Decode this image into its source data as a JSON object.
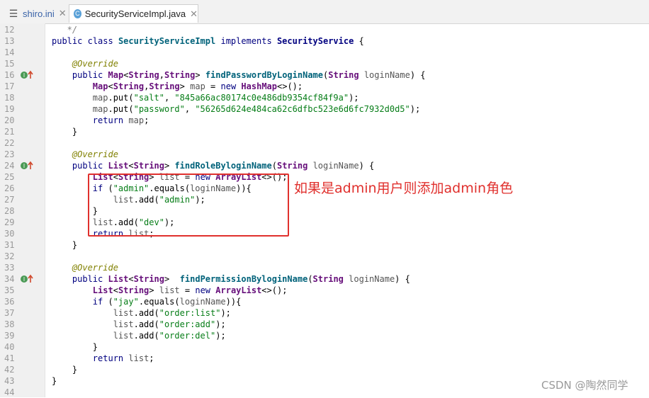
{
  "tabs": [
    {
      "label": "shiro.ini",
      "icon": "ini-file-icon"
    },
    {
      "label": "SecurityServiceImpl.java",
      "icon": "java-class-icon"
    }
  ],
  "gutter": {
    "line_numbers": [
      "12",
      "13",
      "14",
      "15",
      "16",
      "17",
      "18",
      "19",
      "20",
      "21",
      "22",
      "23",
      "24",
      "25",
      "26",
      "27",
      "28",
      "29",
      "30",
      "31",
      "32",
      "33",
      "34",
      "35",
      "36",
      "37",
      "38",
      "39",
      "40",
      "41",
      "42",
      "43",
      "44"
    ],
    "override_markers": [
      "16",
      "24",
      "34"
    ]
  },
  "code": [
    "   */",
    "public class SecurityServiceImpl implements SecurityService {",
    "",
    "    @Override",
    "    public Map<String,String> findPasswordByLoginName(String loginName) {",
    "        Map<String,String> map = new HashMap<>();",
    "        map.put(\"salt\", \"845a66ac80174c0e486db9354cf84f9a\");",
    "        map.put(\"password\", \"56265d624e484ca62c6dfbc523e6d6fc7932d0d5\");",
    "        return map;",
    "    }",
    "",
    "    @Override",
    "    public List<String> findRoleByloginName(String loginName) {",
    "        List<String> list = new ArrayList<>();",
    "        if (\"admin\".equals(loginName)){",
    "            list.add(\"admin\");",
    "        }",
    "        list.add(\"dev\");",
    "        return list;",
    "    }",
    "",
    "    @Override",
    "    public List<String>  findPermissionByloginName(String loginName) {",
    "        List<String> list = new ArrayList<>();",
    "        if (\"jay\".equals(loginName)){",
    "            list.add(\"order:list\");",
    "            list.add(\"order:add\");",
    "            list.add(\"order:del\");",
    "        }",
    "        return list;",
    "    }",
    "}",
    ""
  ],
  "annotation": {
    "note": "如果是admin用户则添加admin角色",
    "color": "#e0302d"
  },
  "watermark": "CSDN @陶然同学"
}
